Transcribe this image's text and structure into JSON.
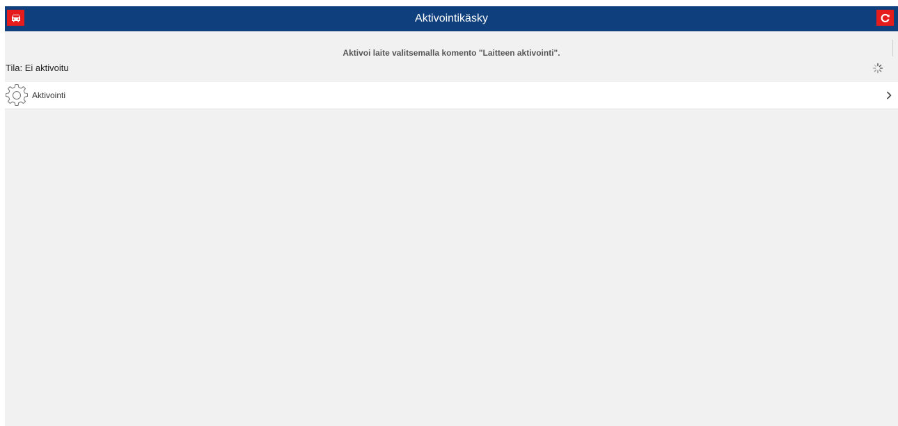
{
  "header": {
    "title": "Aktivointikäsky",
    "left_button_icon": "car-icon",
    "right_button_icon": "refresh-icon",
    "bg_color": "#103f7e",
    "button_color": "#e61c1c"
  },
  "info": {
    "message": "Aktivoi laite valitsemalla komento \"Laitteen aktivointi\".",
    "status": "Tila: Ei aktivoitu",
    "status_icon": "loading-spinner-icon"
  },
  "list": {
    "items": [
      {
        "label": "Aktivointi",
        "icon": "gear-icon",
        "trailing_icon": "chevron-right-icon"
      }
    ]
  }
}
